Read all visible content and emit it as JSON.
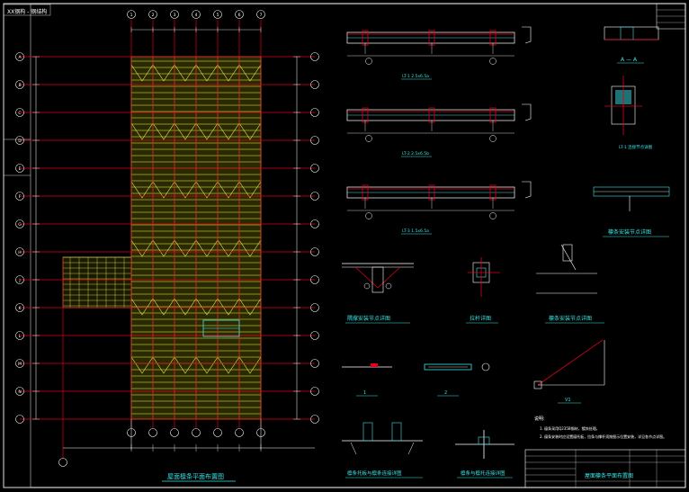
{
  "drawing": {
    "corner_label": "XX钢构 - 钢结构",
    "titles": {
      "plan": "屋面檩条平面布置图",
      "section_a": "A — A",
      "purlin_detail_small": "檩条安装节点详图",
      "brace_node": "隅撑安装节点详图",
      "tie_rod": "拉杆详图",
      "purlin_node": "檩条安装节点详图",
      "purlin_bracket": "檩条托板与檩条连接详图",
      "purlin_anchor": "檩条与檩托连接详图",
      "sheet_name": "屋面檩条平面布置图"
    },
    "beam_labels": [
      "LT-1  2.5x6.5a",
      "LT-2  2.5x6.5b",
      "LT-3  1.5x6.5a"
    ],
    "small_labels": {
      "detail_1": "1",
      "detail_2": "2",
      "detail_v": "V1",
      "notes_head": "说明:"
    },
    "notes": [
      "1. 檩条采用Q235B钢材，镀锌处理。",
      "2. 檩条安装时应设置檩托板，拉条与撑杆须按图示位置安装，详见各节点详图。"
    ],
    "grid_top": [
      "1",
      "2",
      "3",
      "4",
      "5",
      "6",
      "7"
    ],
    "grid_left": [
      "A",
      "B",
      "C",
      "D",
      "E",
      "F",
      "G",
      "H",
      "J",
      "K",
      "L",
      "M",
      "N"
    ]
  },
  "colors": {
    "background": "#000000",
    "grid_line": "#e0001e",
    "purlin": "#f0f050",
    "frame": "#ffffff",
    "annotation": "#39e6e6"
  }
}
